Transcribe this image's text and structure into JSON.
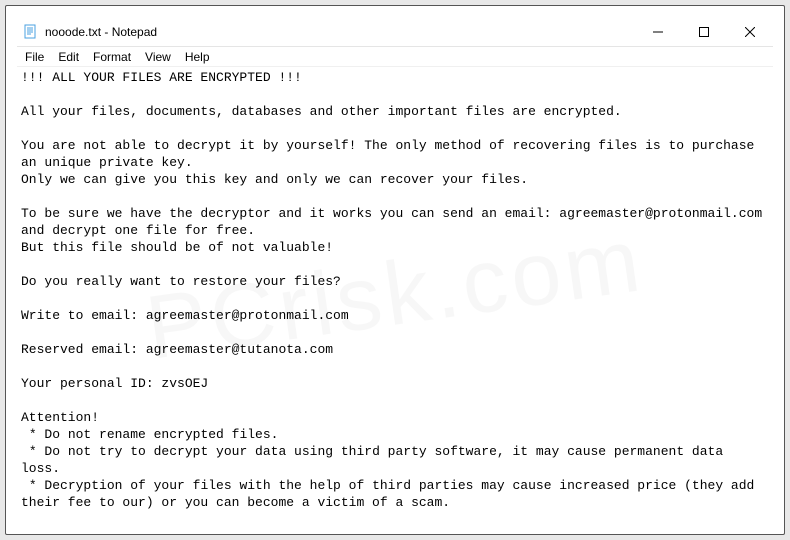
{
  "titlebar": {
    "title": "nooode.txt - Notepad"
  },
  "menubar": {
    "file": "File",
    "edit": "Edit",
    "format": "Format",
    "view": "View",
    "help": "Help"
  },
  "document": {
    "text": "!!! ALL YOUR FILES ARE ENCRYPTED !!!\n\nAll your files, documents, databases and other important files are encrypted.\n\nYou are not able to decrypt it by yourself! The only method of recovering files is to purchase an unique private key.\nOnly we can give you this key and only we can recover your files.\n\nTo be sure we have the decryptor and it works you can send an email: agreemaster@protonmail.com  and decrypt one file for free.\nBut this file should be of not valuable!\n\nDo you really want to restore your files?\n\nWrite to email: agreemaster@protonmail.com\n\nReserved email: agreemaster@tutanota.com\n\nYour personal ID: zvsOEJ\n\nAttention!\n * Do not rename encrypted files.\n * Do not try to decrypt your data using third party software, it may cause permanent data loss.\n * Decryption of your files with the help of third parties may cause increased price (they add their fee to our) or you can become a victim of a scam."
  }
}
